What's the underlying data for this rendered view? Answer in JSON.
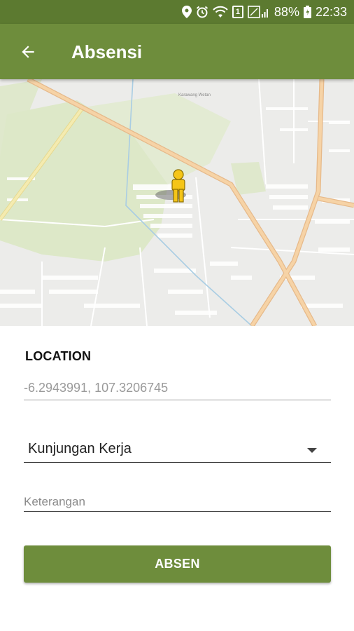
{
  "status_bar": {
    "battery_percent": "88%",
    "time": "22:33",
    "sim_badge": "1",
    "icons": [
      "location-icon",
      "alarm-icon",
      "wifi-icon",
      "sim-icon",
      "signal-icon",
      "battery-icon"
    ]
  },
  "app_bar": {
    "title": "Absensi",
    "back_icon": "arrow-back-icon",
    "color": "#6e8d3c"
  },
  "map": {
    "place_label": "Karawang Wetan",
    "marker_icon": "pegman-icon"
  },
  "form": {
    "location_label": "LOCATION",
    "location_value": "-6.2943991, 107.3206745",
    "type_selected": "Kunjungan Kerja",
    "notes_placeholder": "Keterangan",
    "submit_label": "ABSEN"
  }
}
